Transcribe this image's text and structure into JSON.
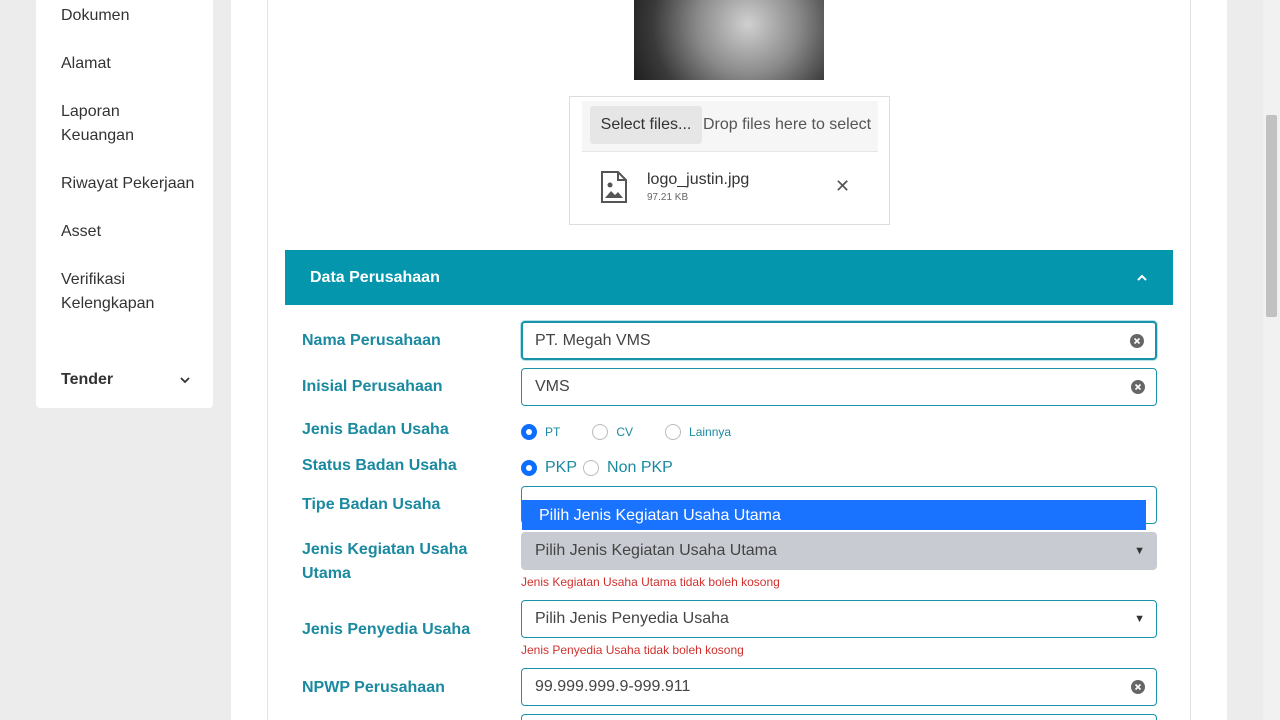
{
  "sidebar": {
    "items": [
      {
        "label": "Dokumen"
      },
      {
        "label": "Alamat"
      },
      {
        "label": "Laporan Keuangan"
      },
      {
        "label": "Riwayat Pekerjaan"
      },
      {
        "label": "Asset"
      },
      {
        "label": "Verifikasi Kelengkapan"
      }
    ],
    "tender_label": "Tender"
  },
  "uploader": {
    "select_label": "Select files...",
    "drop_text": "Drop files here to select",
    "file_name": "logo_justin.jpg",
    "file_size": "97.21 KB"
  },
  "section": {
    "title": "Data Perusahaan"
  },
  "form": {
    "nama_label": "Nama Perusahaan",
    "nama_value": "PT. Megah VMS",
    "inisial_label": "Inisial Perusahaan",
    "inisial_value": "VMS",
    "jenis_badan_label": "Jenis Badan Usaha",
    "jenis_badan_options": [
      "PT",
      "CV",
      "Lainnya"
    ],
    "jenis_badan_selected": "PT",
    "status_label": "Status Badan Usaha",
    "status_options": [
      "PKP",
      "Non PKP"
    ],
    "status_selected": "PKP",
    "tipe_label": "Tipe Badan Usaha",
    "dropdown_highlight": "Pilih Jenis Kegiatan Usaha Utama",
    "kegiatan_label": "Jenis Kegiatan Usaha Utama",
    "kegiatan_value": "Pilih Jenis Kegiatan Usaha Utama",
    "kegiatan_error": "Jenis Kegiatan Usaha Utama tidak boleh kosong",
    "penyedia_label": "Jenis Penyedia Usaha",
    "penyedia_value": "Pilih Jenis Penyedia Usaha",
    "penyedia_error": "Jenis Penyedia Usaha tidak boleh kosong",
    "npwp_label": "NPWP Perusahaan",
    "npwp_value": "99.999.999.9-999.911"
  },
  "colors": {
    "accent": "#0396ac",
    "label": "#1b8aa0",
    "error": "#d0312d",
    "highlight": "#1a73ff"
  }
}
